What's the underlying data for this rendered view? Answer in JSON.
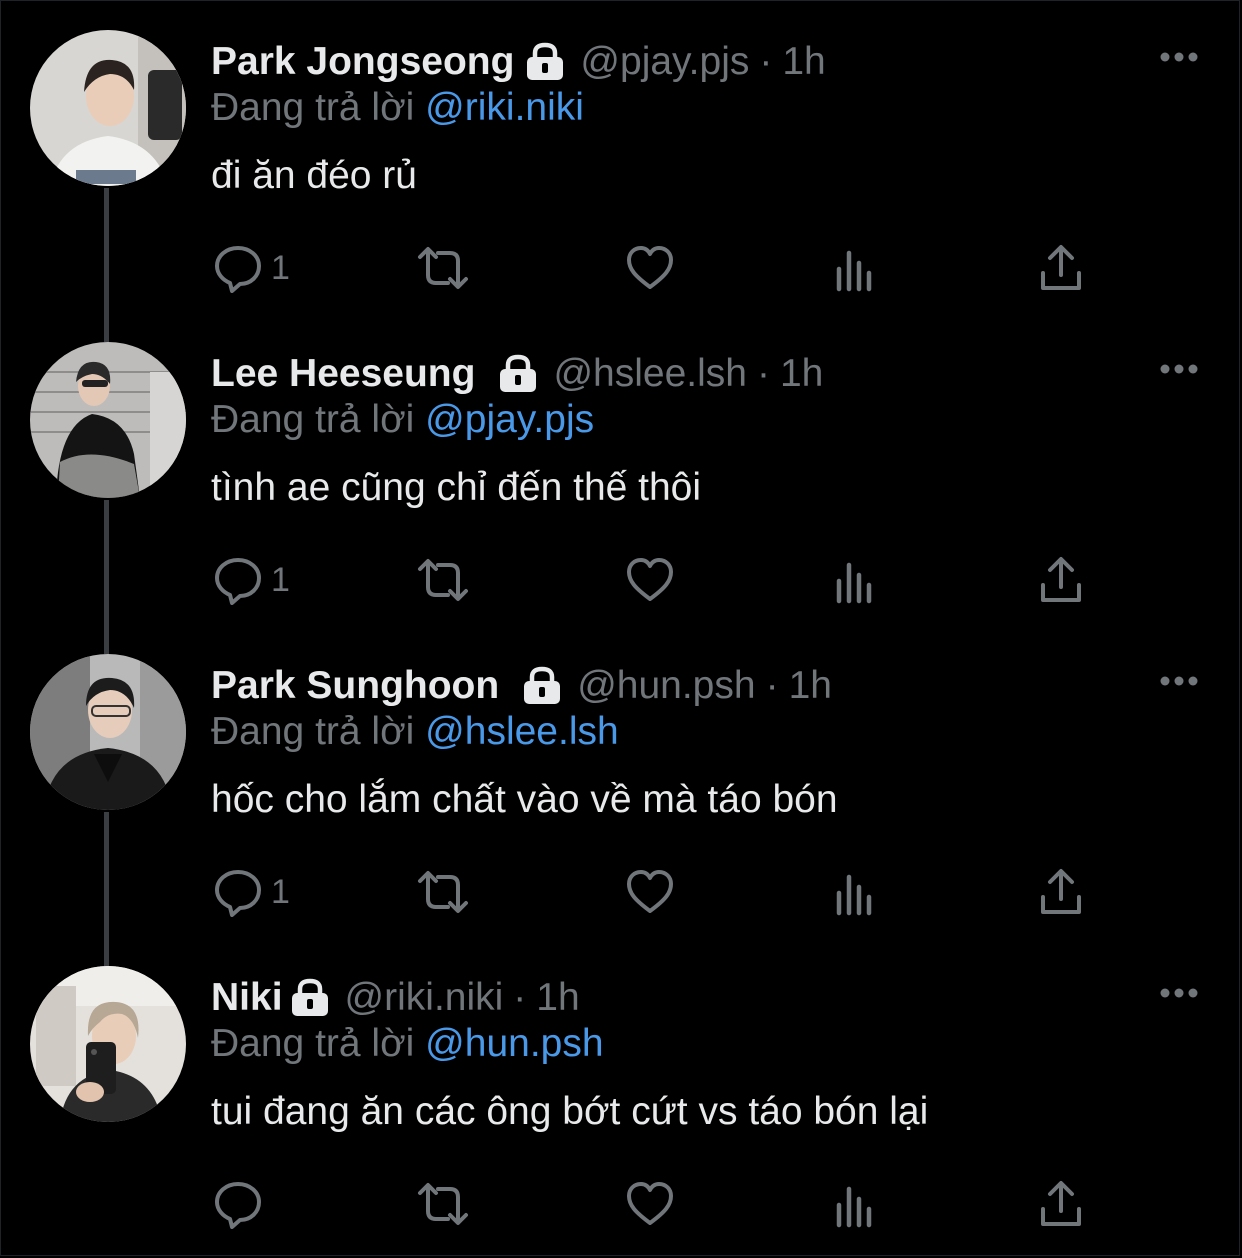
{
  "reply_prefix": "Đang trả lời",
  "tweets": [
    {
      "name": "Park Jongseong",
      "handle": "@pjay.pjs",
      "dot": "·",
      "time": "1h",
      "reply_to": "@riki.niki",
      "text": "đi ăn đéo rủ",
      "reply_count": "1"
    },
    {
      "name": "Lee Heeseung",
      "handle": "@hslee.lsh",
      "dot": "·",
      "time": "1h",
      "reply_to": "@pjay.pjs",
      "text": "tình ae cũng chỉ đến thế thôi",
      "reply_count": "1"
    },
    {
      "name": "Park Sunghoon",
      "handle": "@hun.psh",
      "dot": "·",
      "time": "1h",
      "reply_to": "@hslee.lsh",
      "text": "hốc cho lắm chất vào về mà táo bón",
      "reply_count": "1"
    },
    {
      "name": "Niki",
      "handle": "@riki.niki",
      "dot": "·",
      "time": "1h",
      "reply_to": "@hun.psh",
      "text": "tui đang ăn các ông bớt cứt vs táo bón lại",
      "reply_count": ""
    }
  ],
  "colors": {
    "background": "#000000",
    "primary_text": "#e7e9ea",
    "secondary_text": "#71767b",
    "mention": "#4a99e9",
    "thread_line": "#3a3d41"
  },
  "icons": {
    "reply": "reply-icon",
    "retweet": "retweet-icon",
    "like": "heart-icon",
    "views": "views-icon",
    "share": "share-icon",
    "lock": "lock-icon",
    "more": "more-icon"
  }
}
